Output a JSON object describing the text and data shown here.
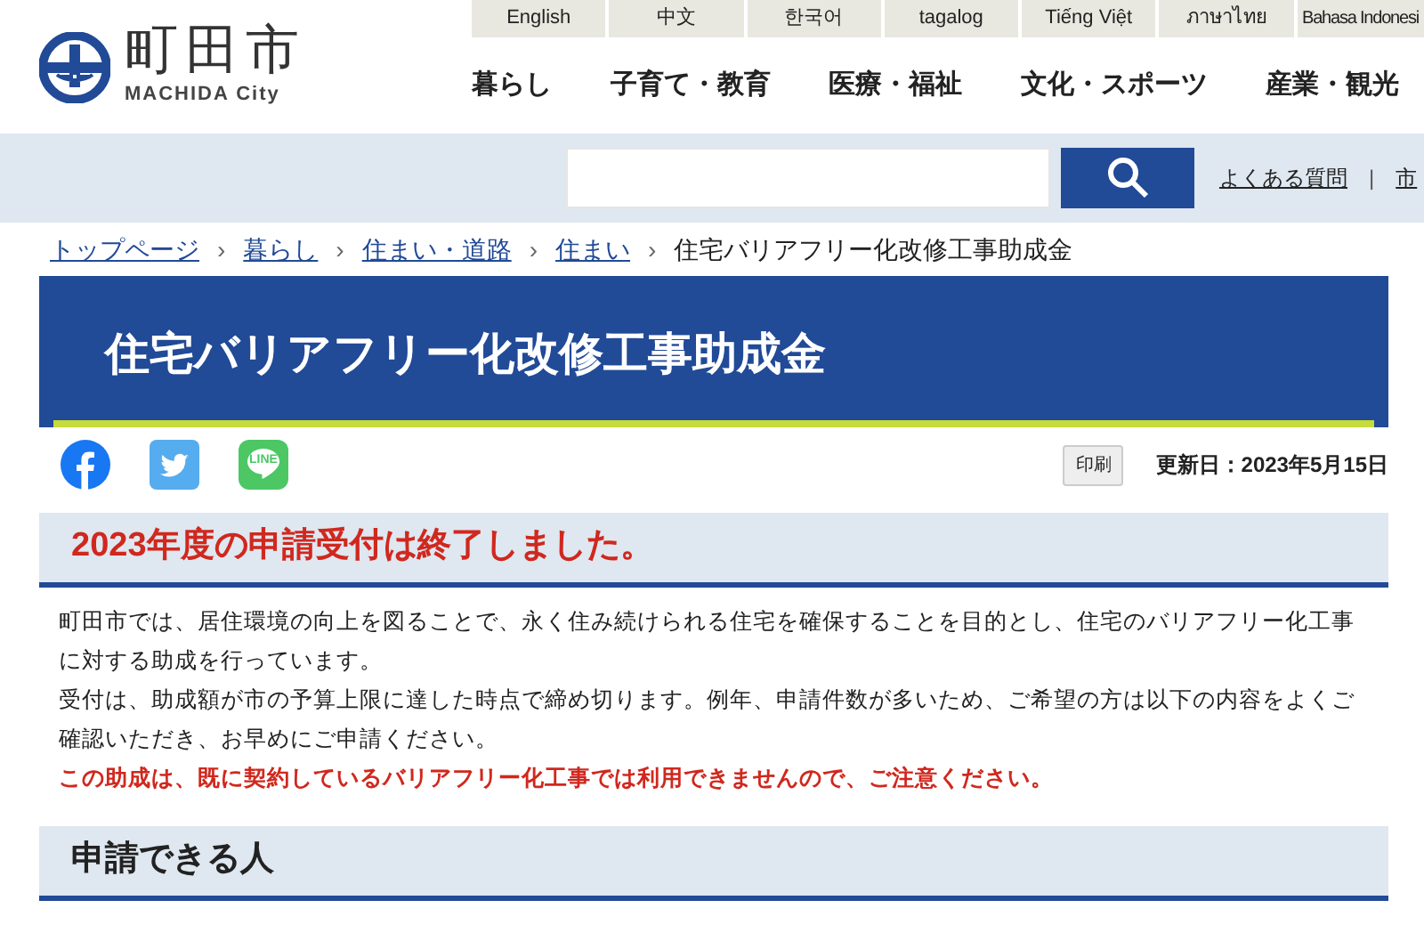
{
  "logo": {
    "name": "町田市",
    "sub": "MACHIDA City"
  },
  "languages": [
    "English",
    "中文",
    "한국어",
    "tagalog",
    "Tiếng Việt",
    "ภาษาไทย",
    "Bahasa Indonesi"
  ],
  "nav": [
    "暮らし",
    "子育て・教育",
    "医療・福祉",
    "文化・スポーツ",
    "産業・観光"
  ],
  "search": {
    "links": [
      "よくある質問",
      "市"
    ],
    "separator": "|"
  },
  "breadcrumb": {
    "separator": "›",
    "items": [
      {
        "label": "トップページ",
        "kind": "link"
      },
      {
        "label": "暮らし",
        "kind": "link"
      },
      {
        "label": "住まい・道路",
        "kind": "link"
      },
      {
        "label": "住まい",
        "kind": "link"
      },
      {
        "label": "住宅バリアフリー化改修工事助成金",
        "kind": "current"
      }
    ]
  },
  "page_title": "住宅バリアフリー化改修工事助成金",
  "share": [
    {
      "kind": "facebook"
    },
    {
      "kind": "twitter"
    },
    {
      "kind": "line",
      "label": "LINE"
    }
  ],
  "print_button": "印刷",
  "updated": "更新日：2023年5月15日",
  "sections": [
    {
      "heading": "2023年度の申請受付は終了しました。",
      "kind": "alert",
      "paragraphs": [
        {
          "text": "町田市では、居住環境の向上を図ることで、永く住み続けられる住宅を確保することを目的とし、住宅のバリアフリー化工事に対する助成を行っています。",
          "kind": "normal"
        },
        {
          "text": "受付は、助成額が市の予算上限に達した時点で締め切ります。例年、申請件数が多いため、ご希望の方は以下の内容をよくご確認いただき、お早めにご申請ください。",
          "kind": "normal"
        },
        {
          "text": "この助成は、既に契約しているバリアフリー化工事では利用できませんので、ご注意ください。",
          "kind": "warning"
        }
      ]
    },
    {
      "heading": "申請できる人",
      "kind": "normal"
    }
  ]
}
